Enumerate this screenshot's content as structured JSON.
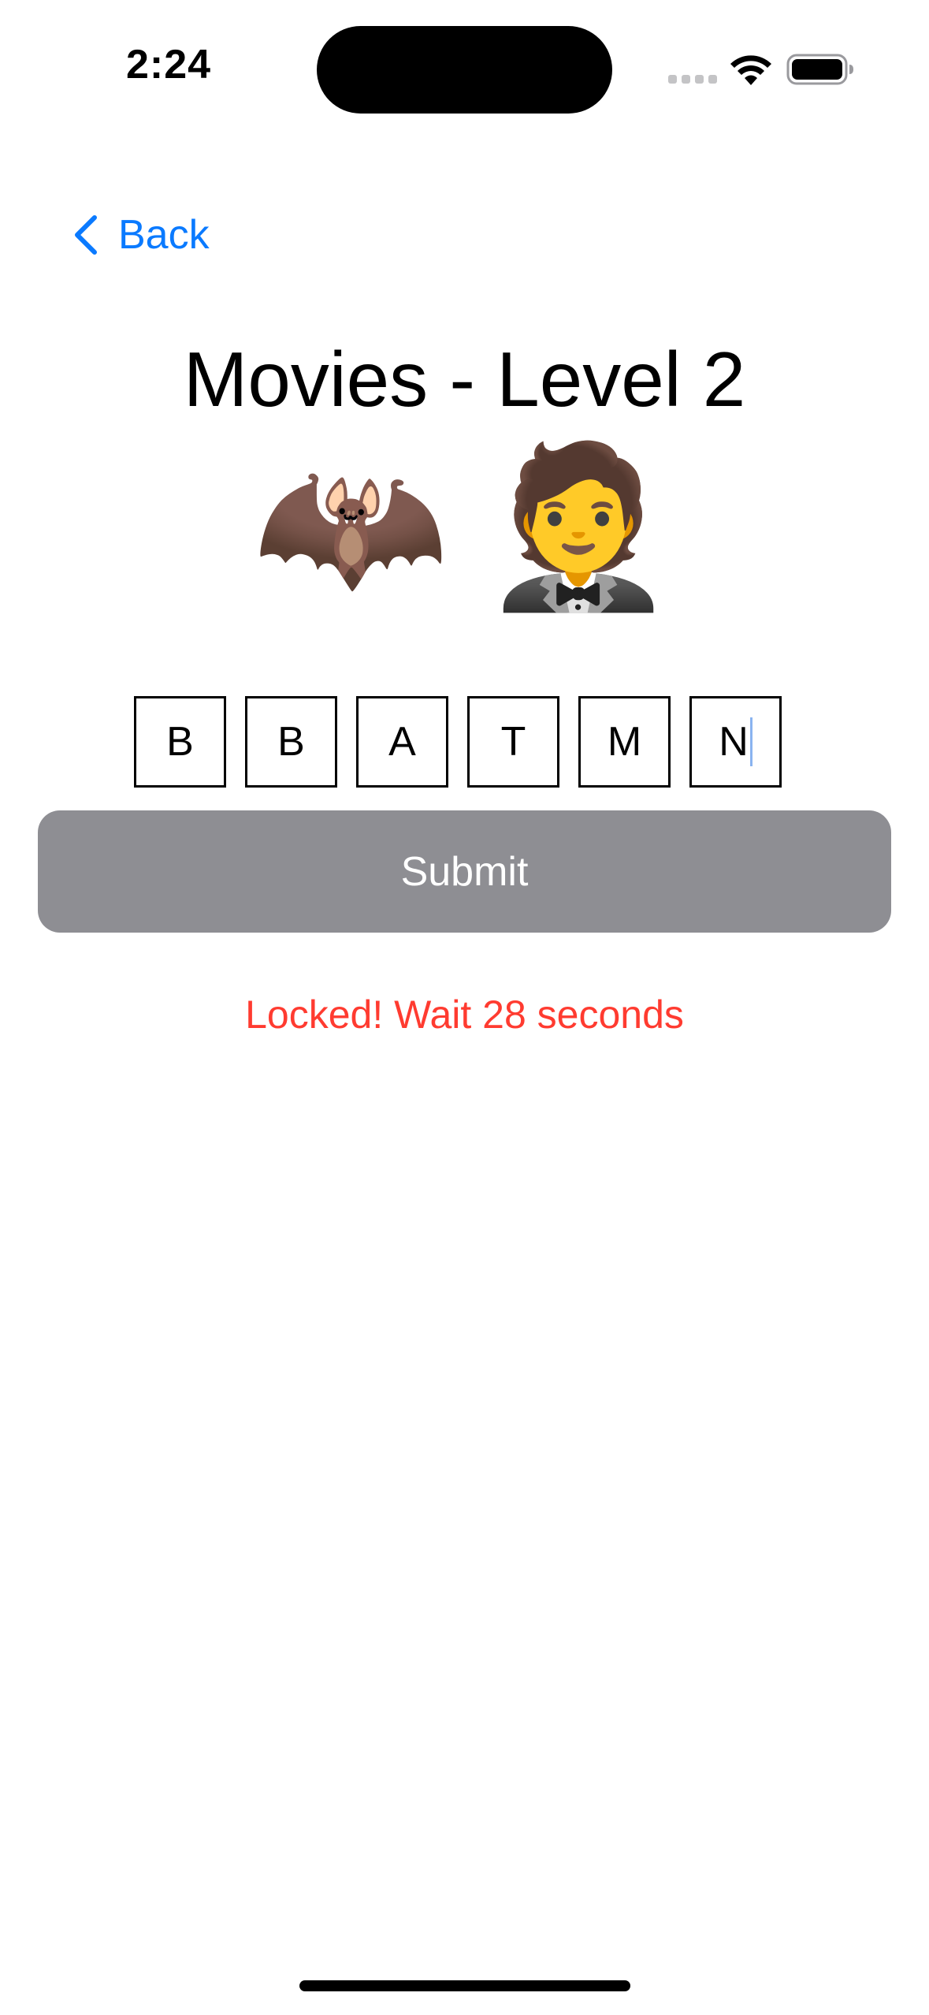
{
  "status_bar": {
    "time": "2:24"
  },
  "nav": {
    "back_label": "Back",
    "accent_color": "#0a7aff"
  },
  "game": {
    "title": "Movies - Level 2",
    "emojis": [
      "🦇",
      "🤵"
    ],
    "letters": [
      "B",
      "B",
      "A",
      "T",
      "M",
      "N"
    ],
    "submit_label": "Submit",
    "lock_message": "Locked! Wait 28 seconds",
    "lock_color": "#ff3b30",
    "submit_disabled_color": "#8e8e93"
  },
  "icons": {
    "signal": "cellular-signal-icon",
    "wifi": "wifi-icon",
    "battery": "battery-icon",
    "back": "chevron-left-icon"
  }
}
